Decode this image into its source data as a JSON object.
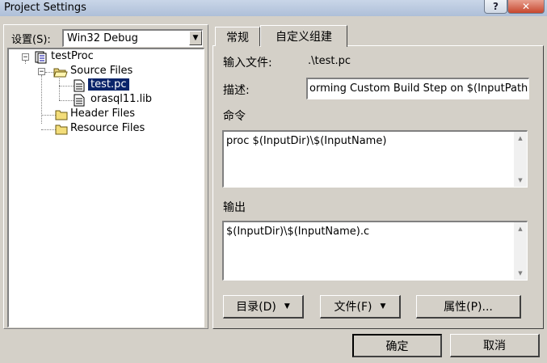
{
  "window": {
    "title": "Project Settings",
    "help_glyph": "?",
    "close_glyph": "✕"
  },
  "left": {
    "settings_label": "设置(S):",
    "config_value": "Win32 Debug",
    "tree": {
      "project": "testProc",
      "source_folder": "Source Files",
      "file_selected": "test.pc",
      "file_lib": "orasql11.lib",
      "header_folder": "Header Files",
      "resource_folder": "Resource Files",
      "collapse_glyph": "−"
    }
  },
  "tabs": [
    {
      "label": "常规"
    },
    {
      "label": "自定义组建"
    }
  ],
  "custom_build": {
    "input_file_label": "输入文件:",
    "input_file_value": ".\\test.pc",
    "description_label": "描述:",
    "description_value": "orming Custom Build Step on $(InputPath)",
    "commands_label": "命令",
    "commands_value": "proc $(InputDir)\\$(InputName)",
    "outputs_label": "输出",
    "outputs_value": "$(InputDir)\\$(InputName).c"
  },
  "buttons": {
    "directory": "目录(D)",
    "files": "文件(F)",
    "properties": "属性(P)...",
    "ok": "确定",
    "cancel": "取消",
    "dropdown_glyph": "▼"
  },
  "colors": {
    "selection": "#0a246a",
    "titlebar": "#b9c9df",
    "dialog": "#d4d0c8"
  }
}
